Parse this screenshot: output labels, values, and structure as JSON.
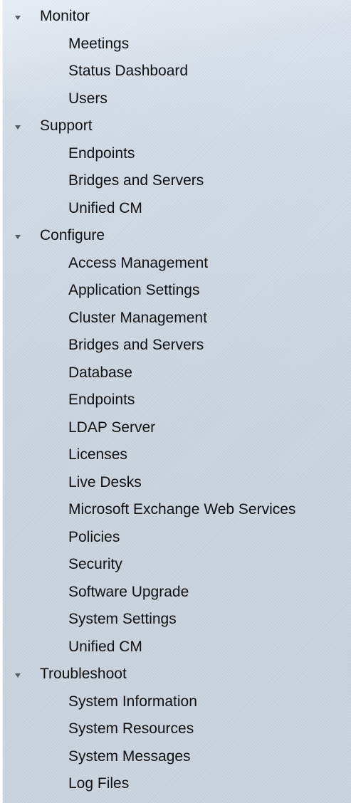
{
  "navigation": {
    "sections": [
      {
        "title": "Monitor",
        "items": [
          "Meetings",
          "Status Dashboard",
          "Users"
        ]
      },
      {
        "title": "Support",
        "items": [
          "Endpoints",
          "Bridges and Servers",
          "Unified CM"
        ]
      },
      {
        "title": "Configure",
        "items": [
          "Access Management",
          "Application Settings",
          "Cluster Management",
          "Bridges and Servers",
          "Database",
          "Endpoints",
          "LDAP Server",
          "Licenses",
          "Live Desks",
          "Microsoft Exchange Web Services",
          "Policies",
          "Security",
          "Software Upgrade",
          "System Settings",
          "Unified CM"
        ]
      },
      {
        "title": "Troubleshoot",
        "items": [
          "System Information",
          "System Resources",
          "System Messages",
          "Log Files"
        ]
      }
    ]
  },
  "icons": {
    "section_toggle": "triangle-down-icon"
  },
  "colors": {
    "panel_background": "#cdd8e3",
    "text": "#111111",
    "arrow": "#555a60"
  }
}
